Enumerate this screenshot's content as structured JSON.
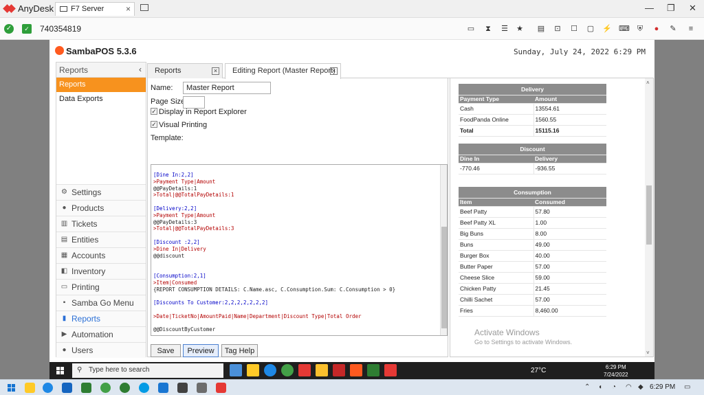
{
  "anydesk": {
    "brand": "AnyDesk",
    "tab_label": "F7 Server",
    "address": "740354819"
  },
  "samba": {
    "app_title": "SambaPOS 5.3.6",
    "datetime": "Sunday, July 24, 2022 6:29 PM",
    "nav": {
      "header": "Reports",
      "items": [
        "Reports",
        "Data Exports"
      ],
      "buttons": [
        "Settings",
        "Products",
        "Tickets",
        "Entities",
        "Accounts",
        "Inventory",
        "Printing",
        "Samba Go Menu",
        "Reports",
        "Automation",
        "Users"
      ]
    },
    "tabs": [
      "Reports",
      "Editing Report (Master Report)"
    ],
    "form": {
      "name_label": "Name:",
      "name_value": "Master Report",
      "page_size_label": "Page Size:",
      "page_size_value": "",
      "display_label": "Display in Report Explorer",
      "visual_label": "Visual Printing",
      "template_label": "Template:"
    },
    "template_lines": [
      {
        "text": "[Dine In:2,2]",
        "style": "blue"
      },
      {
        "text": ">Payment Type|Amount",
        "style": "red"
      },
      {
        "text": "@@PayDetails:1",
        "style": "dark"
      },
      {
        "text": ">Total|@@TotalPayDetails:1",
        "style": "red"
      },
      {
        "text": "",
        "style": "dark"
      },
      {
        "text": "[Delivery:2,2]",
        "style": "blue"
      },
      {
        "text": ">Payment Type|Amount",
        "style": "red"
      },
      {
        "text": "@@PayDetails:3",
        "style": "dark"
      },
      {
        "text": ">Total|@@TotalPayDetails:3",
        "style": "red"
      },
      {
        "text": "",
        "style": "dark"
      },
      {
        "text": "[Discount :2,2]",
        "style": "blue"
      },
      {
        "text": ">Dine In|Delivery",
        "style": "red"
      },
      {
        "text": "@@discount",
        "style": "dark"
      },
      {
        "text": "",
        "style": "dark"
      },
      {
        "text": "",
        "style": "dark"
      },
      {
        "text": "[Consumption:2,1]",
        "style": "blue"
      },
      {
        "text": ">Item|Consumed",
        "style": "red"
      },
      {
        "text": "{REPORT CONSUMPTION DETAILS: C.Name.asc, C.Consumption.Sum: C.Consumption > 0}",
        "style": "dark"
      },
      {
        "text": "",
        "style": "dark"
      },
      {
        "text": "[Discounts To Customer:2,2,2,2,2,2,2]",
        "style": "blue"
      },
      {
        "text": "",
        "style": "dark"
      },
      {
        "text": ">Date|TicketNo|AmountPaid|Name|Department|Discount Type|Total Order",
        "style": "red"
      },
      {
        "text": "",
        "style": "dark"
      },
      {
        "text": "@@DiscountByCustomer",
        "style": "dark"
      }
    ],
    "buttons": {
      "save": "Save",
      "preview": "Preview",
      "tag_help": "Tag Help"
    },
    "preview": {
      "delivery": {
        "title": "Delivery",
        "columns": [
          "Payment Type",
          "Amount"
        ],
        "rows": [
          [
            "Cash",
            "13554.61"
          ],
          [
            "FoodPanda Online",
            "1560.55"
          ]
        ],
        "total": [
          "Total",
          "15115.16"
        ]
      },
      "discount": {
        "title": "Discount",
        "columns": [
          "Dine In",
          "Delivery"
        ],
        "rows": [
          [
            "-770.46",
            "-936.55"
          ]
        ]
      },
      "consumption": {
        "title": "Consumption",
        "columns": [
          "Item",
          "Consumed"
        ],
        "rows": [
          [
            "Beef Patty",
            "57.80"
          ],
          [
            "Beef Patty XL",
            "1.00"
          ],
          [
            "Big Buns",
            "8.00"
          ],
          [
            "Buns",
            "49.00"
          ],
          [
            "Burger Box",
            "40.00"
          ],
          [
            "Butter Paper",
            "57.00"
          ],
          [
            "Cheese Slice",
            "59.00"
          ],
          [
            "Chicken Patty",
            "21.45"
          ],
          [
            "Chilli Sachet",
            "57.00"
          ],
          [
            "Fries",
            "8,460.00"
          ]
        ]
      }
    },
    "watermark": {
      "line1": "Activate Windows",
      "line2": "Go to Settings to activate Windows."
    }
  },
  "remote_taskbar": {
    "search_placeholder": "Type here to search",
    "temperature": "27°C",
    "time": "6:29 PM",
    "date": "7/24/2022"
  },
  "local_taskbar": {
    "time": "6:29 PM"
  }
}
